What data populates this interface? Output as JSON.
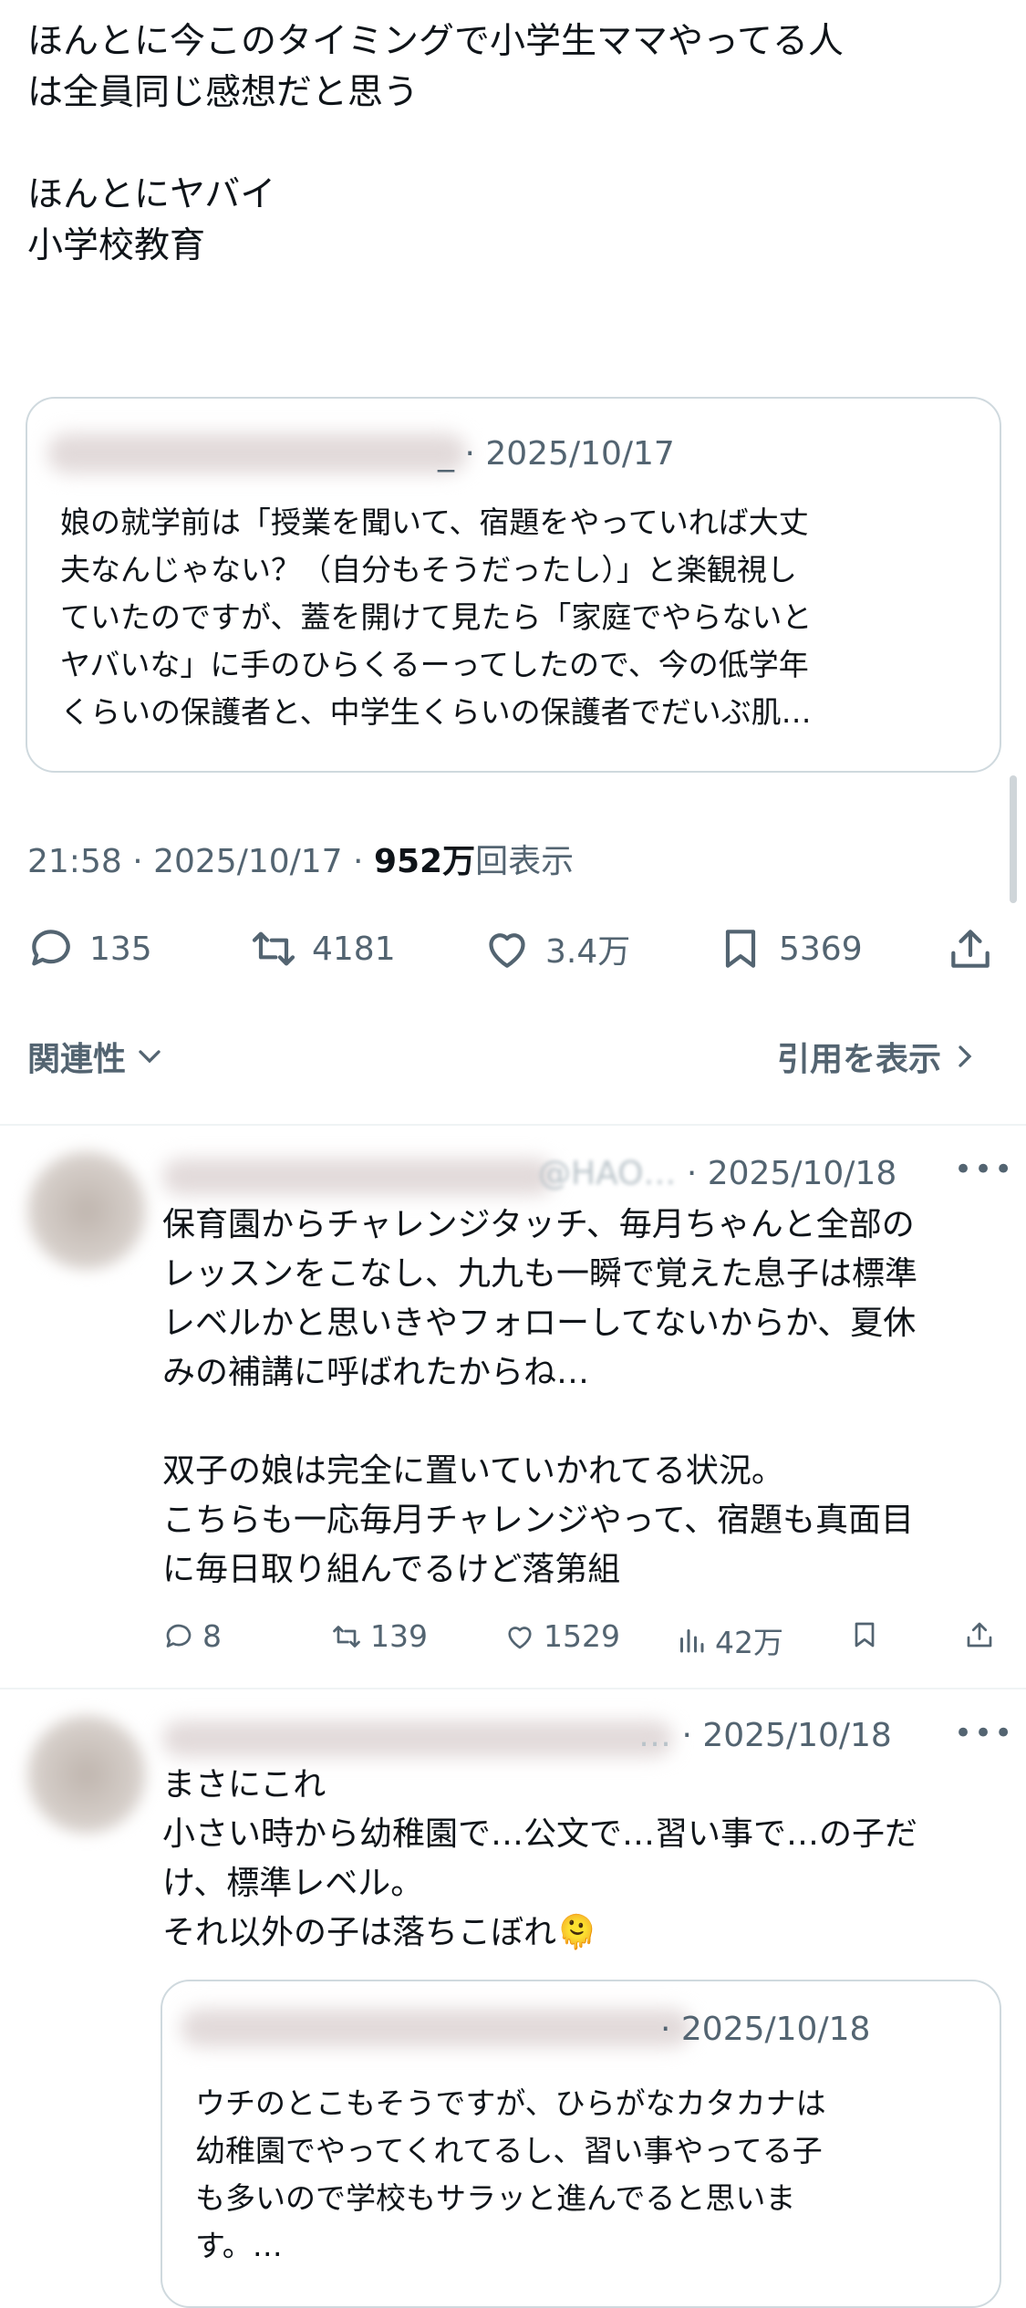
{
  "post": {
    "text": "ほんとに今このタイミングで小学生ママやってる人\nは全員同じ感想だと思う\n\nほんとにヤバイ\n小学校教育",
    "quote": {
      "handle_tail": "_",
      "date": "2025/10/17",
      "text": "娘の就学前は「授業を聞いて、宿題をやっていれば大丈\n夫なんじゃない？（自分もそうだったし）」と楽観視し\nていたのですが、蓋を開けて見たら「家庭でやらないと\nヤバいな」に手のひらくるーってしたので、今の低学年\nくらいの保護者と、中学生くらいの保護者でだいぶ肌…"
    },
    "meta": {
      "time": "21:58",
      "date": "2025/10/17",
      "views_number": "952",
      "views_unit": "万",
      "views_label": "回表示"
    },
    "stats": {
      "replies": "135",
      "reposts": "4181",
      "likes": "3.4万",
      "bookmarks": "5369"
    },
    "related_label": "関連性",
    "quotes_link": "引用を表示"
  },
  "replies": [
    {
      "handle_partial": "@HAO…",
      "date": "2025/10/18",
      "text": "保育園からチャレンジタッチ、毎月ちゃんと全部の\nレッスンをこなし、九九も一瞬で覚えた息子は標準\nレベルかと思いきやフォローしてないからか、夏休\nみの補講に呼ばれたからね…\n\n双子の娘は完全に置いていかれてる状況。\nこちらも一応毎月チャレンジやって、宿題も真面目\nに毎日取り組んでるけど落第組",
      "replies": "8",
      "reposts": "139",
      "likes": "1529",
      "views": "42万"
    },
    {
      "handle_partial": "…",
      "date": "2025/10/18",
      "text": "まさにこれ\n小さい時から幼稚園で…公文で…習い事で…の子だ\nけ、標準レベル。\nそれ以外の子は落ちこぼれ",
      "emoji": "🫠",
      "quote": {
        "date": "2025/10/18",
        "text": "ウチのとこもそうですが、ひらがなカタカナは\n幼稚園でやってくれてるし、習い事やってる子\nも多いので学校もサラッと進んでると思いま\nす。…"
      }
    }
  ],
  "icons": [
    "reply-icon",
    "repost-icon",
    "like-icon",
    "bookmark-icon",
    "share-icon",
    "views-icon",
    "more-icon",
    "chevron-down-icon",
    "chevron-right-icon"
  ],
  "colors": {
    "text": "#0f1419",
    "secondary": "#536471",
    "border": "#cfd9de",
    "divider": "#eff3f4"
  }
}
